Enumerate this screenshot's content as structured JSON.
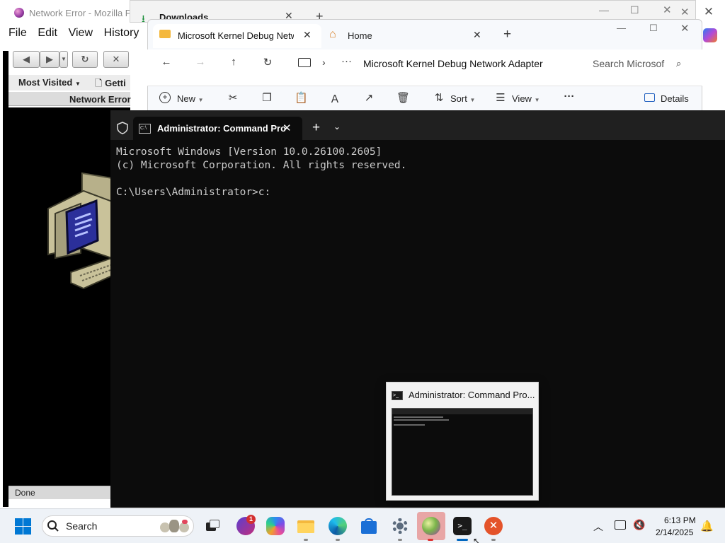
{
  "firefox": {
    "title": "Network Error - Mozilla Fir",
    "menu": [
      "File",
      "Edit",
      "View",
      "History"
    ],
    "bookmarks": [
      "Most Visited",
      "Getti"
    ],
    "tab_title": "Network Error",
    "status": "Done"
  },
  "downloads": {
    "tab_label": "Downloads"
  },
  "explorer": {
    "tab_active_label": "Microsoft Kernel Debug Netwo",
    "tab_home_label": "Home",
    "address_path": "Microsoft Kernel Debug Network Adapter",
    "search_placeholder": "Search Microsof",
    "toolbar": {
      "new_label": "New",
      "sort_label": "Sort",
      "view_label": "View",
      "details_label": "Details"
    }
  },
  "terminal": {
    "tab_label": "Administrator: Command Pro",
    "lines": [
      "Microsoft Windows [Version 10.0.26100.2605]",
      "(c) Microsoft Corporation. All rights reserved.",
      "",
      "C:\\Users\\Administrator>c:"
    ]
  },
  "preview": {
    "title": "Administrator: Command Pro..."
  },
  "taskbar": {
    "search_label": "Search",
    "notification_badge": "1",
    "clock_time": "6:13 PM",
    "clock_date": "2/14/2025"
  },
  "colors": {
    "terminal_bg": "#0c0c0c",
    "taskbar_bg": "#eef2f7",
    "accent": "#0078d4"
  }
}
